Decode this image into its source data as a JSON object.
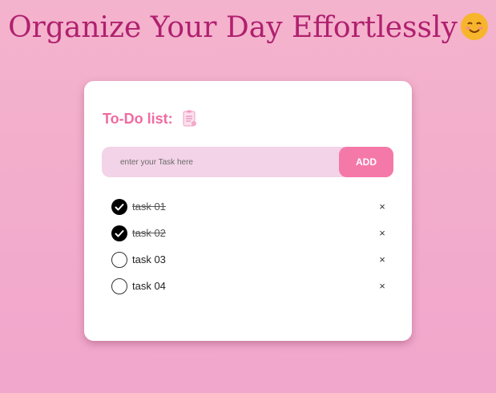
{
  "header": {
    "title": "Organize Your Day Effortlessly"
  },
  "card": {
    "title": "To-Do list:",
    "input": {
      "placeholder": "enter your Task here",
      "value": ""
    },
    "add_label": "ADD",
    "items": [
      {
        "label": "task 01",
        "done": true
      },
      {
        "label": "task 02",
        "done": true
      },
      {
        "label": "task 03",
        "done": false
      },
      {
        "label": "task 04",
        "done": false
      }
    ],
    "remove_glyph": "×"
  },
  "colors": {
    "accent": "#f479a8",
    "title": "#b0206e",
    "card_title": "#f06ba1"
  }
}
